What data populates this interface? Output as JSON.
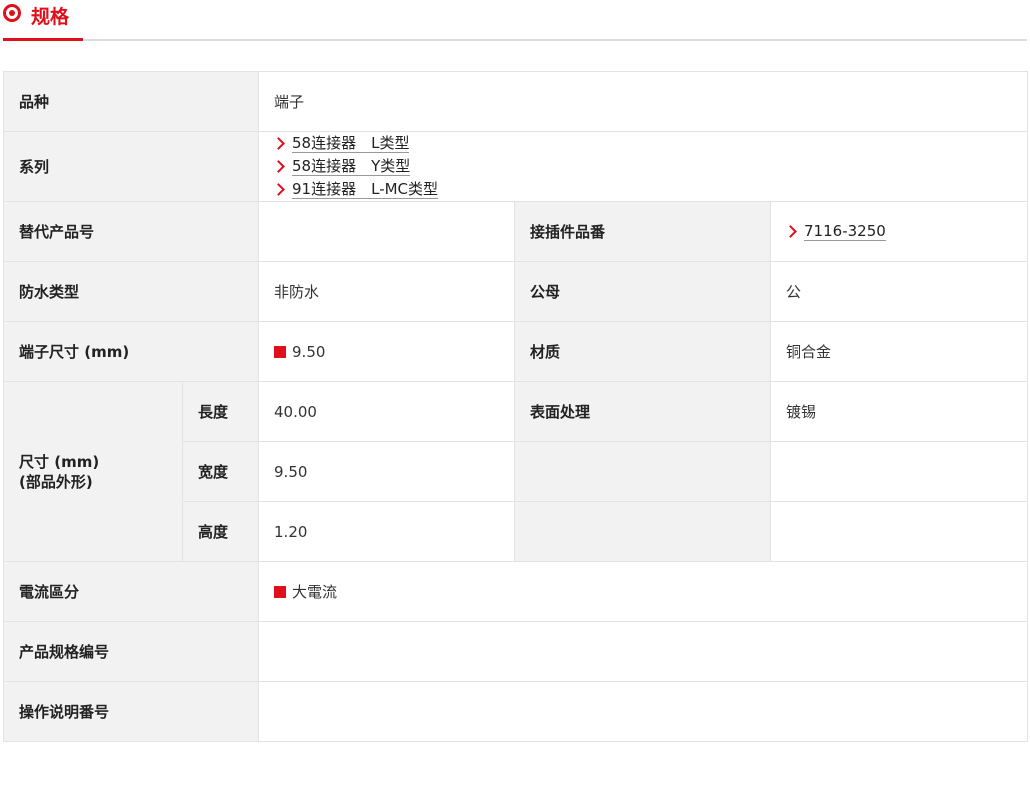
{
  "header": {
    "title": "规格"
  },
  "rows": {
    "variety": {
      "label": "品种",
      "value": "端子"
    },
    "series": {
      "label": "系列",
      "links": [
        "58连接器　L类型",
        "58连接器　Y类型",
        "91连接器　L-MC类型"
      ]
    },
    "alt_part": {
      "label": "替代产品号",
      "value": ""
    },
    "mating_part": {
      "label": "接插件品番",
      "value": "7116-3250"
    },
    "waterproof": {
      "label": "防水类型",
      "value": "非防水"
    },
    "gender": {
      "label": "公母",
      "value": "公"
    },
    "terminal_size": {
      "label": "端子尺寸 (mm)",
      "value": "9.50"
    },
    "material": {
      "label": "材质",
      "value": "铜合金"
    },
    "dimensions": {
      "label_line1": "尺寸 (mm)",
      "label_line2": "(部品外形)",
      "length_label": "長度",
      "length": "40.00",
      "width_label": "宽度",
      "width": "9.50",
      "height_label": "高度",
      "height": "1.20"
    },
    "surface": {
      "label": "表面处理",
      "value": "镀锡"
    },
    "current": {
      "label": "電流區分",
      "value": "大電流"
    },
    "spec_no": {
      "label": "产品规格编号",
      "value": ""
    },
    "manual_no": {
      "label": "操作说明番号",
      "value": ""
    }
  },
  "colors": {
    "accent": "#e0101a",
    "label_bg": "#f2f2f2",
    "border": "#e3e3e3"
  },
  "icons": {
    "header": "record-circle-icon",
    "link": "chevron-right-icon",
    "marker": "red-square-icon"
  }
}
